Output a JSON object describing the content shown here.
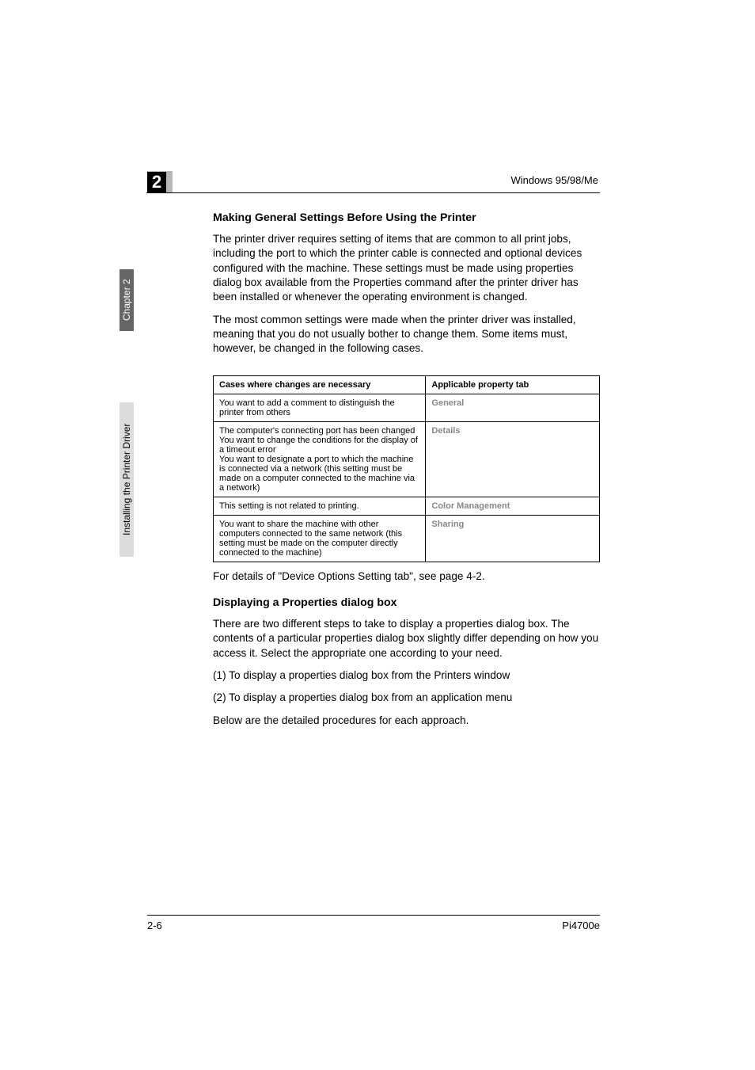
{
  "chapter_number": "2",
  "header_right": "Windows 95/98/Me",
  "side_tab_dark": "Chapter 2",
  "side_tab_light": "Installing the Printer Driver",
  "heading1": "Making General Settings Before Using the Printer",
  "para1": "The printer driver requires setting of items that are common to all print jobs, including the port to which the printer cable is connected and optional devices configured with the machine. These settings must be made using properties dialog box available from the Properties command after the printer driver has been installed or whenever the operating environment is changed.",
  "para2": "The most common settings were made when the printer driver was installed, meaning that you do not usually bother to change them. Some items must, however, be changed in the following cases.",
  "table": {
    "headers": [
      "Cases where changes are necessary",
      "Applicable property tab"
    ],
    "rows": [
      {
        "case": "You want to add a comment to distinguish the printer from others",
        "tab": "General"
      },
      {
        "case": "The computer's connecting port has been changed\nYou want to change the conditions for the display of a timeout error\nYou want to designate a port to which the machine is connected via a network (this setting must be made on a computer connected to the machine via a network)",
        "tab": "Details"
      },
      {
        "case": "This setting is not related to printing.",
        "tab": "Color Management"
      },
      {
        "case": "You want to share the machine with other computers connected to the same network (this setting must be made on the computer directly connected to the machine)",
        "tab": "Sharing"
      }
    ]
  },
  "para_after_table": "For details of \"Device Options Setting tab\", see page 4-2.",
  "heading2": "Displaying a Properties dialog box",
  "para3": "There are two different steps to take to display a properties dialog box. The contents of a particular properties dialog box slightly differ depending on how you access it. Select the appropriate one according to your need.",
  "para4": "(1) To display a properties dialog box from the Printers window",
  "para5": "(2) To display a properties dialog box from an application menu",
  "para6": "Below are the detailed procedures for each approach.",
  "footer_left": "2-6",
  "footer_right": "Pi4700e"
}
